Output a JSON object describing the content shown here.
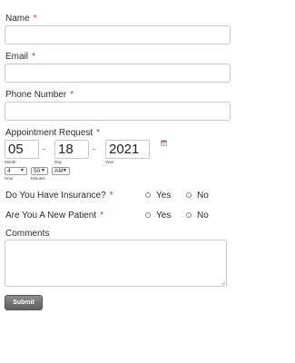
{
  "fields": {
    "name": {
      "label": "Name",
      "required": "*"
    },
    "email": {
      "label": "Email",
      "required": "*"
    },
    "phone": {
      "label": "Phone Number",
      "required": "*"
    }
  },
  "appointment": {
    "label": "Appointment Request",
    "required": "*",
    "month": {
      "value": "05",
      "sublabel": "Month"
    },
    "day": {
      "value": "18",
      "sublabel": "Day"
    },
    "year": {
      "value": "2021",
      "sublabel": "Year"
    },
    "separator": "-",
    "hour": {
      "value": "4",
      "sublabel": "Hour"
    },
    "minutes": {
      "value": "50",
      "sublabel": "Minutes"
    },
    "ampm": {
      "value": "AM"
    },
    "calendar_icon": "calendar-icon"
  },
  "insurance": {
    "question": "Do You Have Insurance?",
    "required": "*",
    "yes": "Yes",
    "no": "No"
  },
  "new_patient": {
    "question": "Are You A New Patient",
    "required": "*",
    "yes": "Yes",
    "no": "No"
  },
  "comments": {
    "label": "Comments"
  },
  "submit": {
    "label": "Submit"
  },
  "colors": {
    "required": "#c0392b",
    "button": "#6e6e6e",
    "border": "#c8c8c8"
  }
}
